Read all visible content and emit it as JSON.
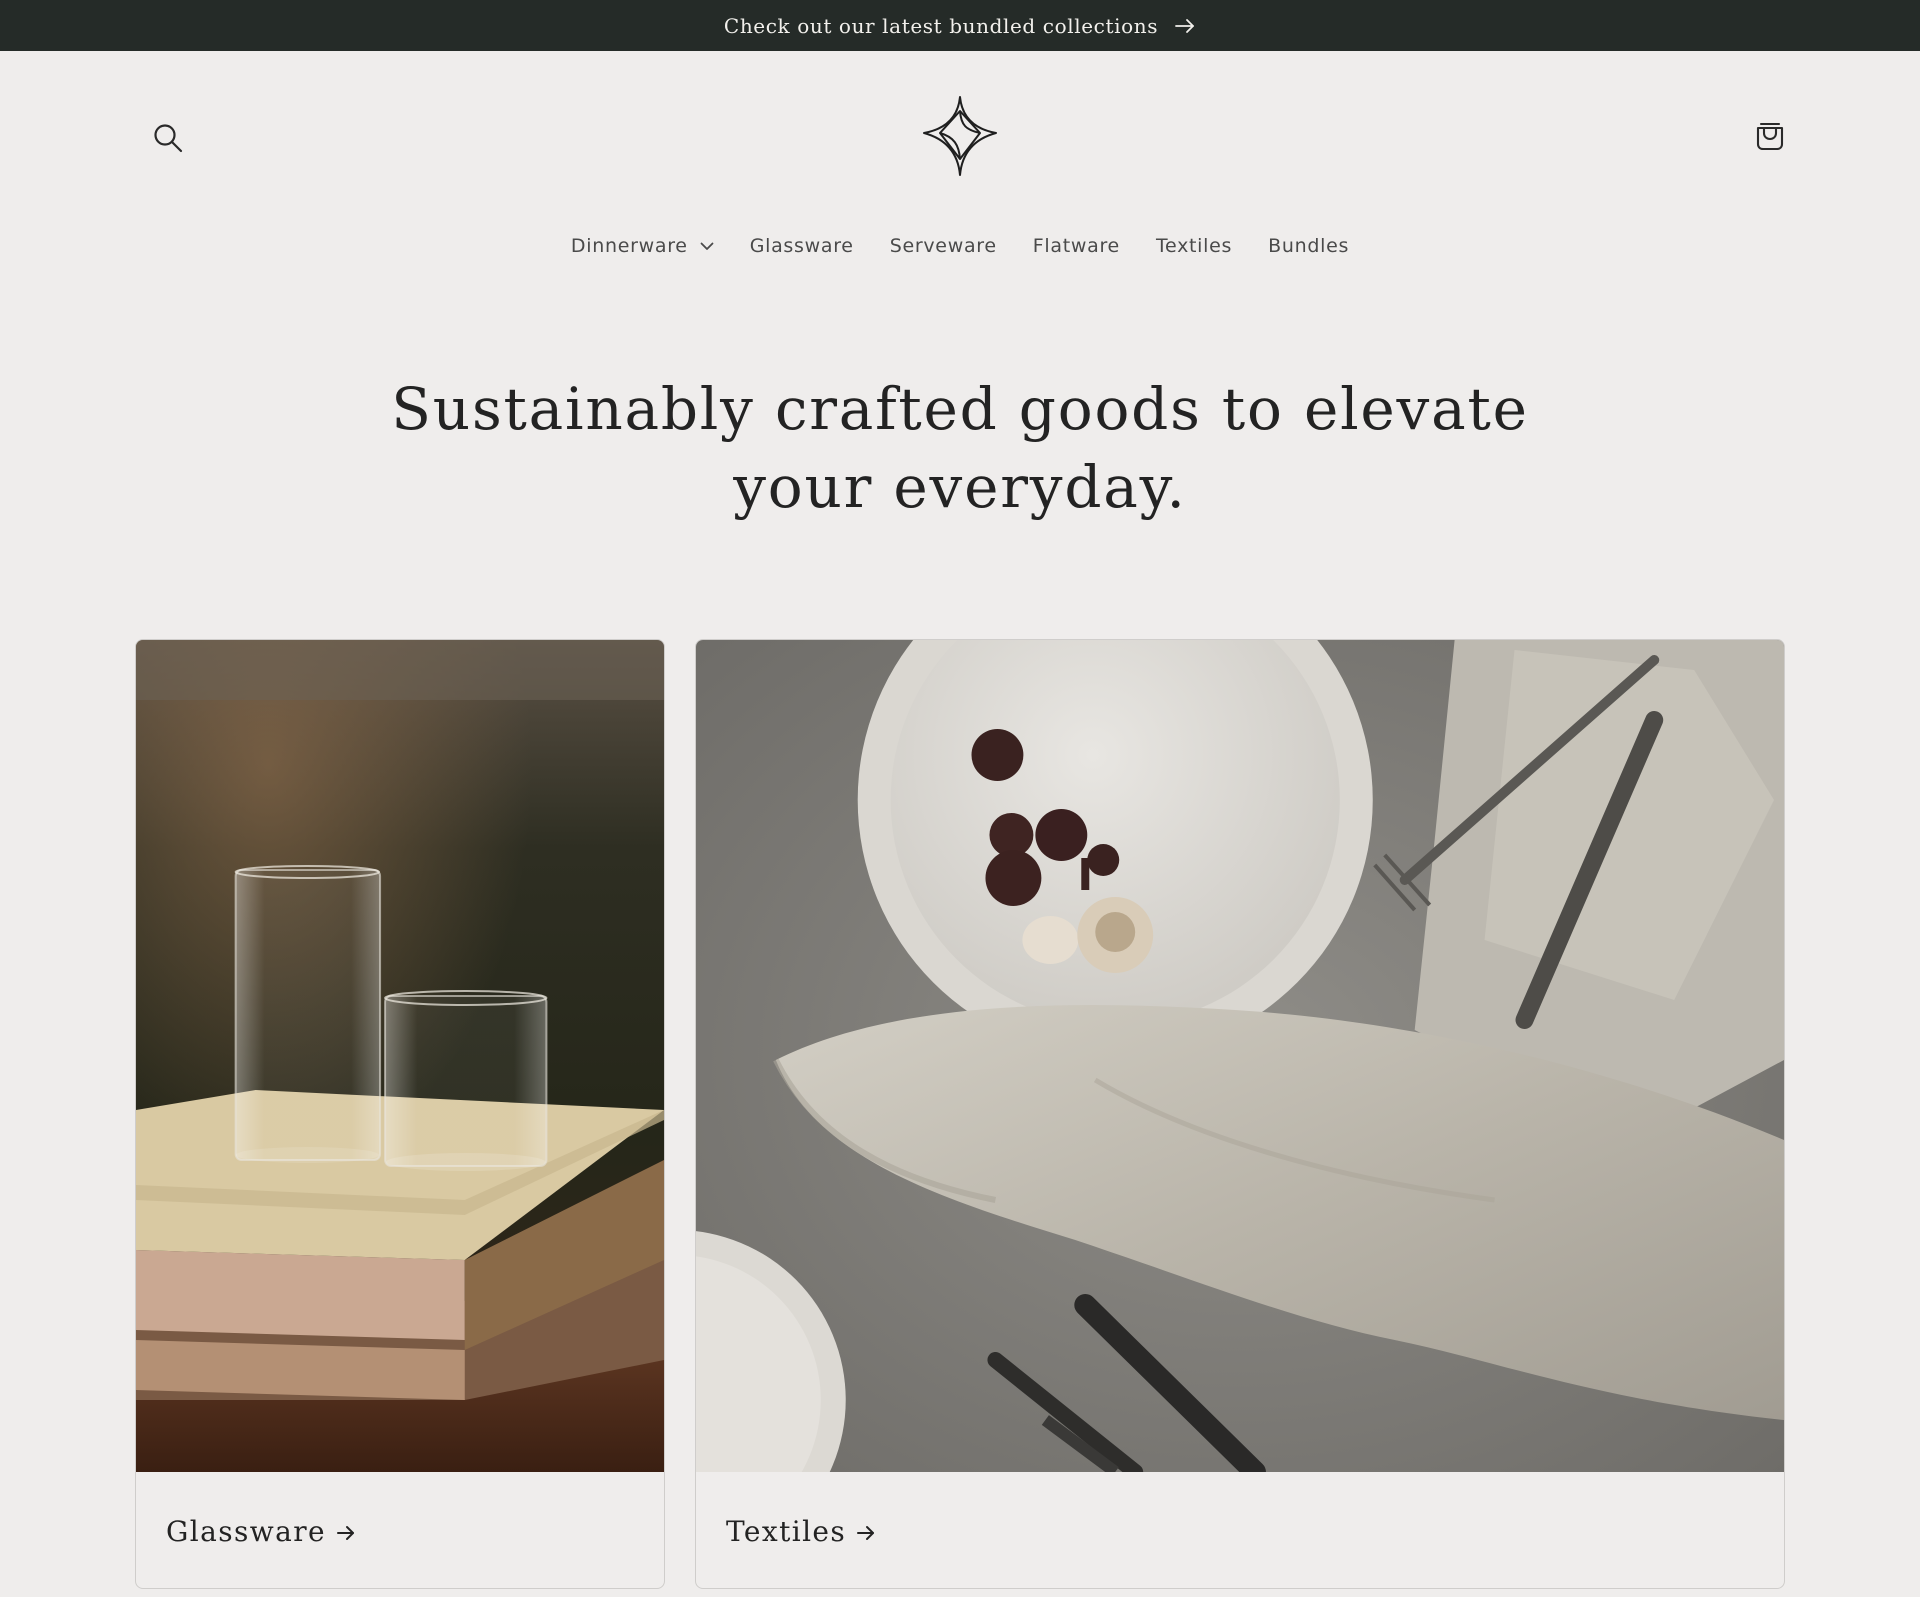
{
  "announcement": {
    "text": "Check out our latest bundled collections",
    "arrow_icon": "arrow-right-icon"
  },
  "header": {
    "search_icon": "search-icon",
    "logo_icon": "four-point-star-logo",
    "cart_icon": "shopping-bag-icon"
  },
  "nav": {
    "items": [
      {
        "label": "Dinnerware",
        "has_dropdown": true
      },
      {
        "label": "Glassware"
      },
      {
        "label": "Serveware"
      },
      {
        "label": "Flatware"
      },
      {
        "label": "Textiles"
      },
      {
        "label": "Bundles"
      }
    ]
  },
  "hero": {
    "heading": "Sustainably crafted goods to elevate your everyday."
  },
  "collections": [
    {
      "title": "Glassware",
      "image": "glasses-on-books-photo"
    },
    {
      "title": "Textiles",
      "image": "plates-napkin-cutlery-photo"
    }
  ],
  "colors": {
    "announcement_bg": "#252b28",
    "page_bg": "#efedec",
    "text": "#232323"
  }
}
